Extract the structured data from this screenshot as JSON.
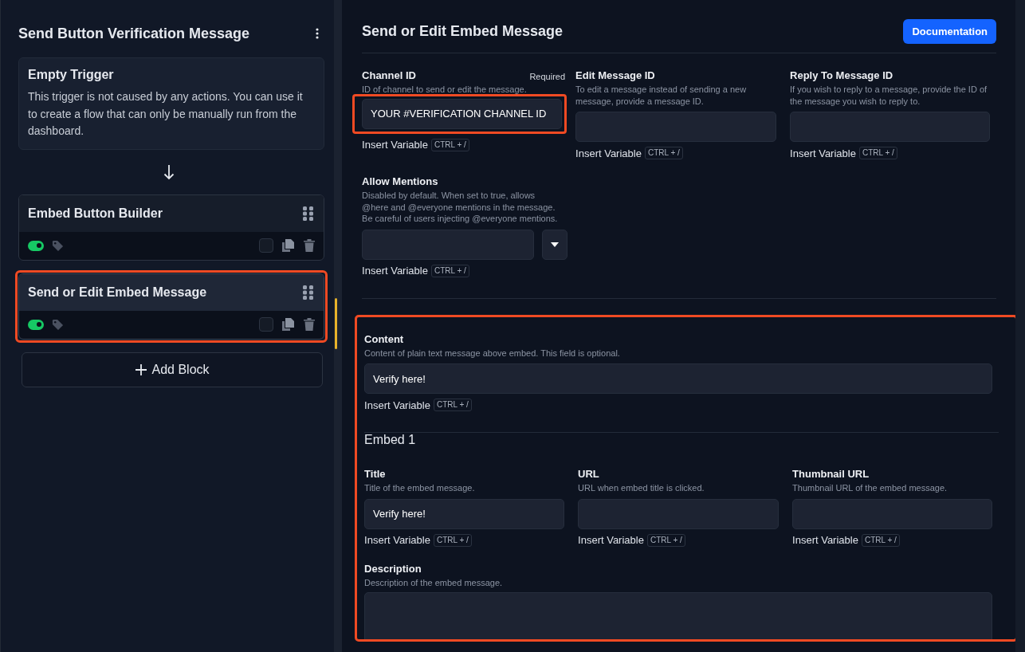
{
  "sidebar": {
    "title": "Send Button Verification Message",
    "trigger": {
      "title": "Empty Trigger",
      "description": "This trigger is not caused by any actions. You can use it to create a flow that can only be manually run from the dashboard."
    },
    "blocks": [
      {
        "title": "Embed Button Builder",
        "enabled": true,
        "checked": false,
        "selected": false,
        "highlighted": false
      },
      {
        "title": "Send or Edit Embed Message",
        "enabled": true,
        "checked": false,
        "selected": true,
        "highlighted": true
      }
    ],
    "add_button": "Add Block"
  },
  "panel": {
    "title": "Send or Edit Embed Message",
    "doc_button": "Documentation",
    "top_fields": [
      {
        "kind": "text",
        "label": "Channel ID",
        "required": "Required",
        "description": "ID of channel to send or edit the message.",
        "value": "YOUR #VERIFICATION CHANNEL ID",
        "highlighted": true,
        "insert_label": "Insert Variable",
        "shortcut": "CTRL + /"
      },
      {
        "kind": "text",
        "label": "Edit Message ID",
        "description": "To edit a message instead of sending a new message, provide a message ID.",
        "highlighted": false,
        "insert_label": "Insert Variable",
        "shortcut": "CTRL + /"
      },
      {
        "kind": "text",
        "label": "Reply To Message ID",
        "description": "If you wish to reply to a message, provide the ID of the message you wish to reply to.",
        "highlighted": false,
        "insert_label": "Insert Variable",
        "shortcut": "CTRL + /"
      },
      {
        "kind": "select",
        "label": "Allow Mentions",
        "description": "Disabled by default. When set to true, allows @here and @everyone mentions in the message. Be careful of users injecting @everyone mentions.",
        "highlighted": false,
        "insert_label": "Insert Variable",
        "shortcut": "CTRL + /"
      }
    ],
    "content_section": {
      "highlighted": true,
      "content": {
        "label": "Content",
        "description": "Content of plain text message above embed. This field is optional.",
        "value": "Verify here!",
        "insert_label": "Insert Variable",
        "shortcut": "CTRL + /"
      },
      "embed_heading": "Embed 1",
      "embed_fields": [
        {
          "label": "Title",
          "description": "Title of the embed message.",
          "value": "Verify here!",
          "insert_label": "Insert Variable",
          "shortcut": "CTRL + /"
        },
        {
          "label": "URL",
          "description": "URL when embed title is clicked.",
          "insert_label": "Insert Variable",
          "shortcut": "CTRL + /"
        },
        {
          "label": "Thumbnail URL",
          "description": "Thumbnail URL of the embed message.",
          "insert_label": "Insert Variable",
          "shortcut": "CTRL + /"
        }
      ],
      "description_field": {
        "label": "Description",
        "description": "Description of the embed message."
      }
    }
  }
}
